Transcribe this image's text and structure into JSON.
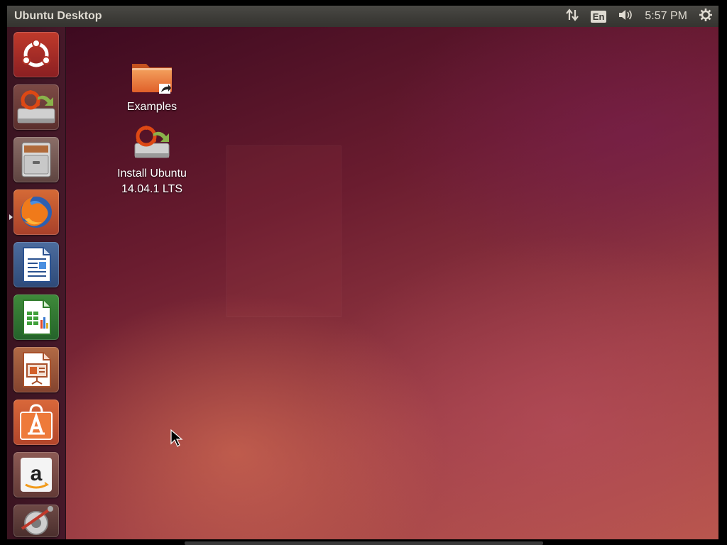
{
  "topbar": {
    "title": "Ubuntu Desktop",
    "language": "En",
    "clock": "5:57 PM",
    "network_icon": "network-arrows-icon",
    "volume_icon": "volume-icon",
    "settings_icon": "gear-icon"
  },
  "launcher": {
    "items": [
      {
        "name": "Dash Home",
        "icon": "ubuntu-logo-icon"
      },
      {
        "name": "Install Ubuntu 14.04.1 LTS",
        "icon": "installer-icon"
      },
      {
        "name": "Files",
        "icon": "file-cabinet-icon"
      },
      {
        "name": "Firefox Web Browser",
        "icon": "firefox-icon"
      },
      {
        "name": "LibreOffice Writer",
        "icon": "writer-icon"
      },
      {
        "name": "LibreOffice Calc",
        "icon": "calc-icon"
      },
      {
        "name": "LibreOffice Impress",
        "icon": "impress-icon"
      },
      {
        "name": "Ubuntu Software Center",
        "icon": "software-center-icon"
      },
      {
        "name": "Amazon",
        "icon": "amazon-icon"
      },
      {
        "name": "System Settings",
        "icon": "system-settings-icon"
      }
    ],
    "active_item": "Firefox Web Browser"
  },
  "desktop": {
    "icons": [
      {
        "label": "Examples",
        "icon": "folder-link-icon"
      },
      {
        "label_line1": "Install Ubuntu",
        "label_line2": "14.04.1 LTS",
        "icon": "installer-icon"
      }
    ]
  },
  "colors": {
    "panel": "#3c3b37",
    "accent": "#dd4814",
    "panel_text": "#dfdbd2"
  }
}
